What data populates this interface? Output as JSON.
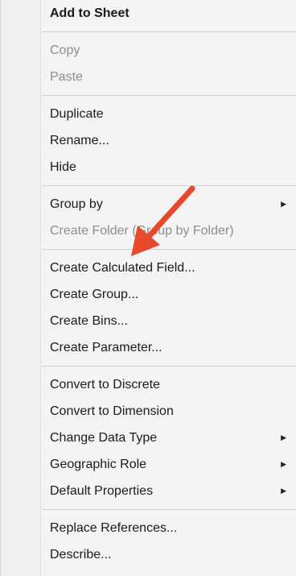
{
  "menu": {
    "groups": [
      [
        {
          "label": "Add to Sheet",
          "bold": true
        }
      ],
      [
        {
          "label": "Copy",
          "disabled": true
        },
        {
          "label": "Paste",
          "disabled": true
        }
      ],
      [
        {
          "label": "Duplicate"
        },
        {
          "label": "Rename..."
        },
        {
          "label": "Hide"
        }
      ],
      [
        {
          "label": "Group by",
          "submenu": true
        },
        {
          "label": "Create Folder (Group by Folder)",
          "disabled": true
        }
      ],
      [
        {
          "label": "Create Calculated Field..."
        },
        {
          "label": "Create Group..."
        },
        {
          "label": "Create Bins..."
        },
        {
          "label": "Create Parameter..."
        }
      ],
      [
        {
          "label": "Convert to Discrete"
        },
        {
          "label": "Convert to Dimension"
        },
        {
          "label": "Change Data Type",
          "submenu": true
        },
        {
          "label": "Geographic Role",
          "submenu": true
        },
        {
          "label": "Default Properties",
          "submenu": true
        }
      ],
      [
        {
          "label": "Replace References..."
        },
        {
          "label": "Describe..."
        }
      ]
    ]
  },
  "icons": {
    "submenu_arrow": "triangle-right-icon",
    "annotation": "red-arrow-icon"
  },
  "colors": {
    "annotation_arrow": "#e8482c",
    "disabled_text": "#8d8d8d"
  }
}
